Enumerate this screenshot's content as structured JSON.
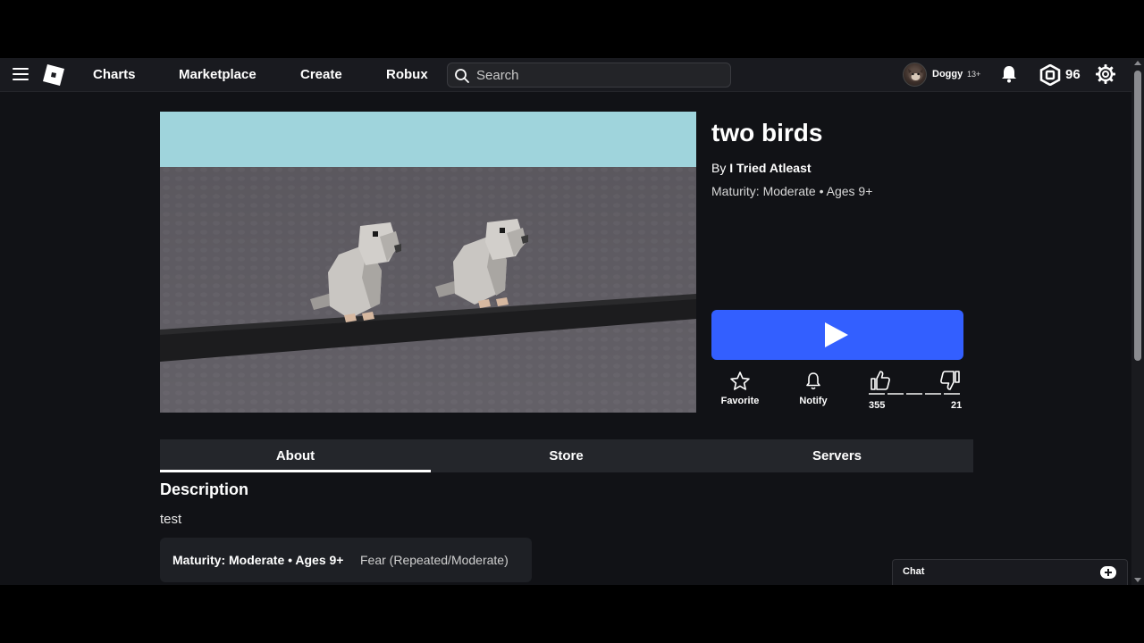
{
  "nav": {
    "links": [
      "Charts",
      "Marketplace",
      "Create",
      "Robux"
    ],
    "search_placeholder": "Search",
    "username": "Doggy",
    "age_tag": "13+",
    "robux": "96"
  },
  "game": {
    "title": "two birds",
    "by_label": "By",
    "creator": "I Tried Atleast",
    "maturity": "Maturity: Moderate • Ages 9+",
    "thumbnail_alt": "two birds thumbnail"
  },
  "actions": {
    "favorite": "Favorite",
    "notify": "Notify",
    "upvotes": "355",
    "downvotes": "21",
    "upvote_ratio": 0.944
  },
  "tabs": [
    {
      "label": "About",
      "active": true
    },
    {
      "label": "Store",
      "active": false
    },
    {
      "label": "Servers",
      "active": false
    }
  ],
  "about": {
    "description_title": "Description",
    "description": "test",
    "maturity_label": "Maturity: Moderate • Ages 9+",
    "maturity_desc": "Fear (Repeated/Moderate)"
  },
  "chat": {
    "label": "Chat"
  },
  "colors": {
    "play_button": "#335fff",
    "background": "#111216",
    "topbar": "#191a1f"
  }
}
